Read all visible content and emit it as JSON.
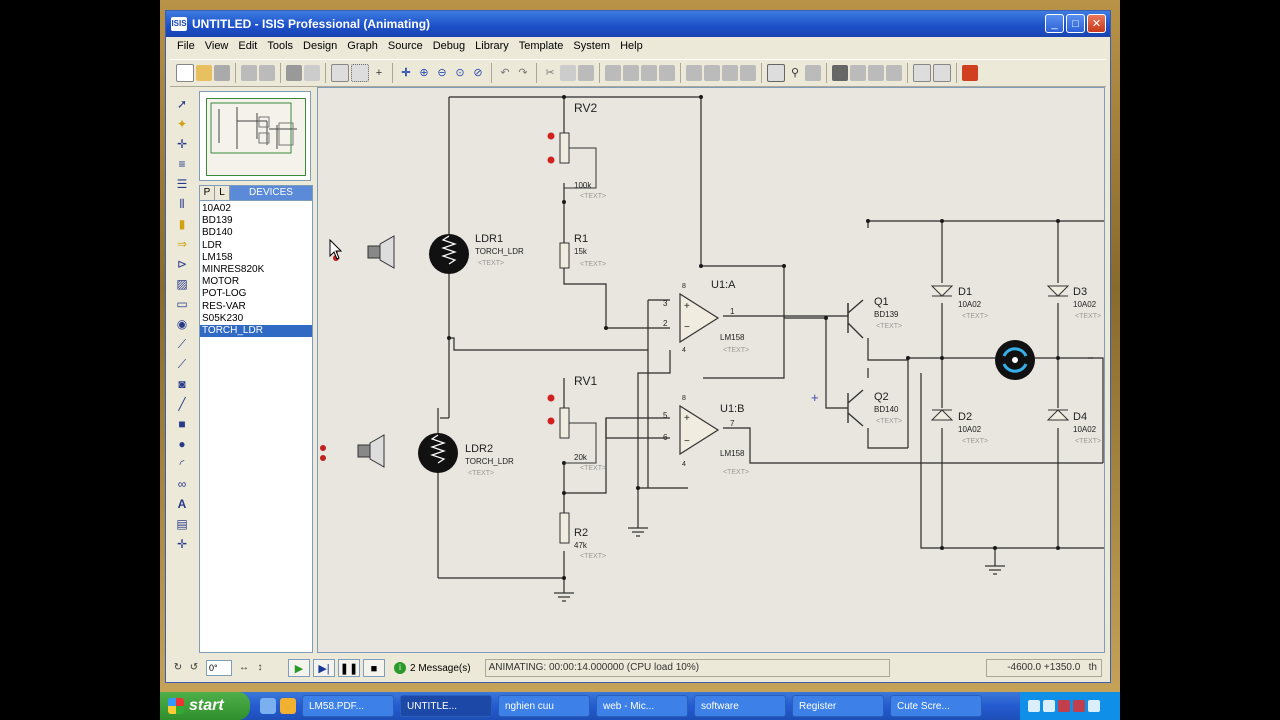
{
  "window": {
    "title": "UNTITLED - ISIS Professional (Animating)",
    "app_badge": "ISIS"
  },
  "menu": [
    "File",
    "View",
    "Edit",
    "Tools",
    "Design",
    "Graph",
    "Source",
    "Debug",
    "Library",
    "Template",
    "System",
    "Help"
  ],
  "device_panel": {
    "tab_p": "P",
    "tab_l": "L",
    "title": "DEVICES",
    "items": [
      "10A02",
      "BD139",
      "BD140",
      "LDR",
      "LM158",
      "MINRES820K",
      "MOTOR",
      "POT-LOG",
      "RES-VAR",
      "S05K230",
      "TORCH_LDR"
    ],
    "selected": "TORCH_LDR"
  },
  "schematic": {
    "rv2": {
      "ref": "RV2",
      "value": "100k",
      "text": "<TEXT>"
    },
    "r1": {
      "ref": "R1",
      "value": "15k",
      "text": "<TEXT>"
    },
    "ldr1": {
      "ref": "LDR1",
      "type": "TORCH_LDR",
      "text": "<TEXT>"
    },
    "ldr2": {
      "ref": "LDR2",
      "type": "TORCH_LDR",
      "text": "<TEXT>"
    },
    "rv1": {
      "ref": "RV1",
      "value": "20k",
      "text": "<TEXT>"
    },
    "r2": {
      "ref": "R2",
      "value": "47k",
      "text": "<TEXT>"
    },
    "u1a": {
      "ref": "U1:A",
      "type": "LM158",
      "text": "<TEXT>",
      "pins": [
        "3",
        "2",
        "1",
        "8",
        "4"
      ]
    },
    "u1b": {
      "ref": "U1:B",
      "type": "LM158",
      "text": "<TEXT>",
      "pins": [
        "5",
        "6",
        "7",
        "8",
        "4"
      ]
    },
    "q1": {
      "ref": "Q1",
      "type": "BD139",
      "text": "<TEXT>"
    },
    "q2": {
      "ref": "Q2",
      "type": "BD140",
      "text": "<TEXT>"
    },
    "d1": {
      "ref": "D1",
      "type": "10A02",
      "text": "<TEXT>"
    },
    "d2": {
      "ref": "D2",
      "type": "10A02",
      "text": "<TEXT>"
    },
    "d3": {
      "ref": "D3",
      "type": "10A02",
      "text": "<TEXT>"
    },
    "d4": {
      "ref": "D4",
      "type": "10A02",
      "text": "<TEXT>"
    }
  },
  "statusbar": {
    "angle": "0°",
    "messages": "2 Message(s)",
    "status": "ANIMATING: 00:00:14.000000 (CPU load 10%)",
    "coords": "-4600.0  +1350.0",
    "units": "th"
  },
  "taskbar": {
    "start": "start",
    "tasks": [
      "LM58.PDF...",
      "UNTITLE...",
      "nghien cuu",
      "web - Mic...",
      "software",
      "Register",
      "Cute Scre..."
    ],
    "active_task": "UNTITLE..."
  }
}
